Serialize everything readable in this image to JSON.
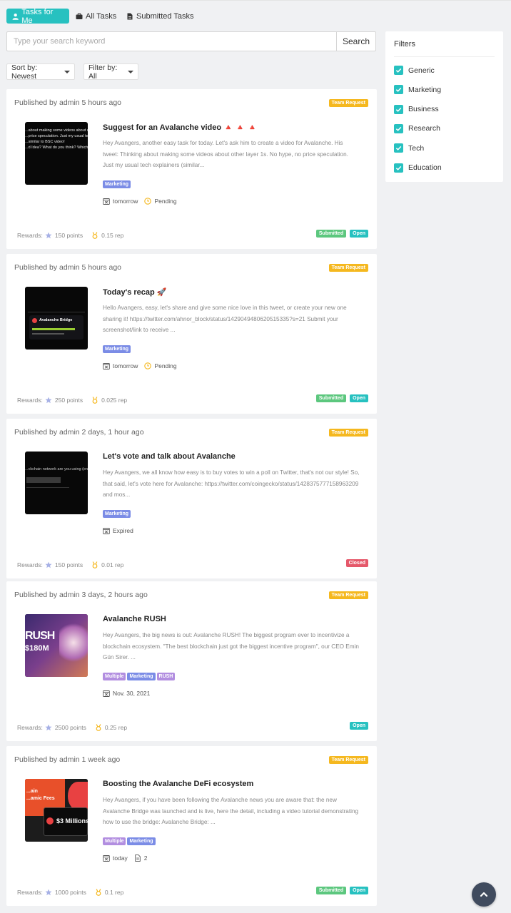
{
  "tabs": [
    {
      "label": "Tasks for Me",
      "icon": "user-icon"
    },
    {
      "label": "All Tasks",
      "icon": "briefcase-icon"
    },
    {
      "label": "Submitted Tasks",
      "icon": "file-icon"
    }
  ],
  "search": {
    "placeholder": "Type your search keyword",
    "value": "",
    "button_label": "Search"
  },
  "sort": {
    "label": "Sort by: Newest"
  },
  "filter": {
    "label": "Filter by: All"
  },
  "filters_panel": {
    "title": "Filters",
    "items": [
      {
        "label": "Generic",
        "checked": true
      },
      {
        "label": "Marketing",
        "checked": true
      },
      {
        "label": "Business",
        "checked": true
      },
      {
        "label": "Research",
        "checked": true
      },
      {
        "label": "Tech",
        "checked": true
      },
      {
        "label": "Education",
        "checked": true
      }
    ]
  },
  "labels": {
    "rewards": "Rewards:"
  },
  "colors": {
    "accent": "#27c1c0",
    "team_request": "#f5b81f",
    "submitted": "#5cc77e",
    "open": "#27c1c0",
    "closed": "#e5586a",
    "tag_marketing": "#7b8ce6",
    "tag_multiple": "#b28ee0",
    "tag_rush": "#b28ee0"
  },
  "tasks": [
    {
      "published": "Published by admin 5 hours ago",
      "type": "Team Request",
      "title": "Suggest for an Avalanche video 🔺 🔺 🔺",
      "desc": "Hey Avangers, another easy task for today. Let's ask him to create a video for Avalanche.   His tweet: Thinking about making some videos about other layer 1s. No hype, no price speculation. Just my usual tech explainers (similar...",
      "tags": [
        "Marketing"
      ],
      "due": "tomorrow",
      "status": "Pending",
      "count": "",
      "points": "150 points",
      "rep": "0.15 rep",
      "badges": [
        "Submitted",
        "Open"
      ],
      "thumb_lines": [
        "...about making some videos about other",
        "",
        "...price speculation. Just my usual te",
        "...similar to BSC video!",
        "",
        "...d Idea? What do you think? Which on"
      ]
    },
    {
      "published": "Published by admin 5 hours ago",
      "type": "Team Request",
      "title": "Today's recap 🚀",
      "desc": "Hello Avangers, easy, let's share and give some nice love in this tweet, or create your new one sharing it!   https://twitter.com/ahnor_block/status/1429049480620515335?s=21   Submit your screenshot/link to receive ...",
      "tags": [
        "Marketing"
      ],
      "due": "tomorrow",
      "status": "Pending",
      "count": "",
      "points": "250 points",
      "rep": "0.025 rep",
      "badges": [
        "Submitted",
        "Open"
      ],
      "thumb_lines": [
        "Avalanche Bridge"
      ]
    },
    {
      "published": "Published by admin 2 days, 1 hour ago",
      "type": "Team Request",
      "title": "Let's vote and talk about Avalanche",
      "desc": "Hey Avangers, we all know how easy is to buy votes to win a poll on Twitter, that's not our style! So, that said, let's vote here for Avalanche: https://twitter.com/coingecko/status/1428375777158963209   and mos...",
      "tags": [
        "Marketing"
      ],
      "due": "Expired",
      "status": "",
      "count": "",
      "points": "150 points",
      "rep": "0.01 rep",
      "badges": [
        "Closed"
      ],
      "thumb_lines": [
        "...ckchain network are you using (eng) ro"
      ]
    },
    {
      "published": "Published by admin 3 days, 2 hours ago",
      "type": "Team Request",
      "title": "Avalanche RUSH",
      "desc": "Hey Avangers, the big news is out: Avalanche RUSH! The biggest program ever to incentivize a blockchain ecosystem.   \"The best blockchain just got the biggest incentive program\", our CEO Emin Gün Sirer. ...",
      "tags": [
        "Multiple",
        "Marketing",
        "RUSH"
      ],
      "due": "Nov. 30, 2021",
      "status": "",
      "count": "",
      "points": "2500 points",
      "rep": "0.25 rep",
      "badges": [
        "Open"
      ],
      "thumb_lines": [
        "RUSH",
        "$180M"
      ]
    },
    {
      "published": "Published by admin 1 week ago",
      "type": "Team Request",
      "title": "Boosting the Avalanche DeFi ecosystem",
      "desc": "Hey Avangers, if you have been following the Avalanche news you are aware that: the new Avalanche Bridge was launched and is live, here the detail, including a video tutorial demonstrating how to use the bridge: Avalanche Bridge: ...",
      "tags": [
        "Multiple",
        "Marketing"
      ],
      "due": "today",
      "status": "",
      "count": "2",
      "points": "1000 points",
      "rep": "0.1 rep",
      "badges": [
        "Submitted",
        "Open"
      ],
      "thumb_lines": [
        "...ain",
        "...amic Fees",
        "$3 Millions"
      ]
    }
  ]
}
